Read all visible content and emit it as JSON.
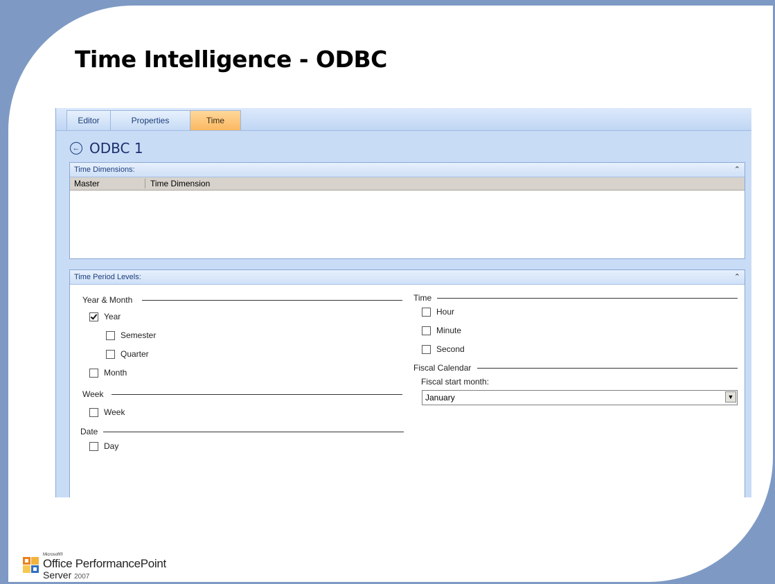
{
  "slide": {
    "title": "Time Intelligence - ODBC"
  },
  "tabs": [
    {
      "label": "Editor",
      "active": false
    },
    {
      "label": "Properties",
      "active": false
    },
    {
      "label": "Time",
      "active": true
    }
  ],
  "object": {
    "name": "ODBC 1"
  },
  "time_dimensions": {
    "header": "Time Dimensions:",
    "columns": [
      "Master",
      "Time Dimension"
    ],
    "rows": []
  },
  "time_period_levels": {
    "header": "Time Period Levels:",
    "year_month": {
      "label": "Year & Month",
      "year": {
        "label": "Year",
        "checked": true
      },
      "semester": {
        "label": "Semester",
        "checked": false
      },
      "quarter": {
        "label": "Quarter",
        "checked": false
      },
      "month": {
        "label": "Month",
        "checked": false
      }
    },
    "week_group": {
      "label": "Week",
      "week": {
        "label": "Week",
        "checked": false
      }
    },
    "date_group": {
      "label": "Date",
      "day": {
        "label": "Day",
        "checked": false
      }
    },
    "time_group": {
      "label": "Time",
      "hour": {
        "label": "Hour",
        "checked": false
      },
      "minute": {
        "label": "Minute",
        "checked": false
      },
      "second": {
        "label": "Second",
        "checked": false
      }
    },
    "fiscal": {
      "label": "Fiscal Calendar",
      "start_month_label": "Fiscal start month:",
      "start_month_value": "January"
    }
  },
  "branding": {
    "microsoft": "Microsoft®",
    "product": "Office PerformancePoint",
    "edition": "Server",
    "year": "2007"
  },
  "colors": {
    "accent": "#fbb862",
    "frame": "#7e9ac4",
    "panel_bg": "#c9dcf6"
  }
}
